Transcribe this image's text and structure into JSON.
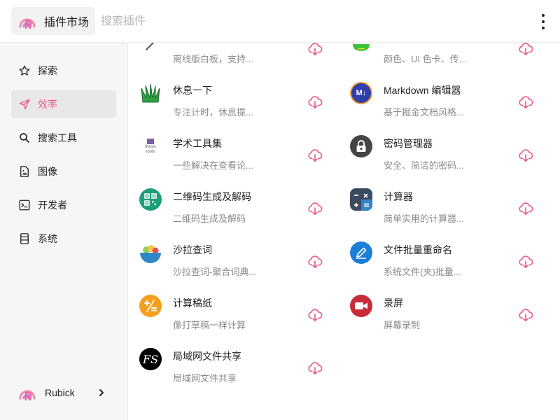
{
  "header": {
    "title": "插件市场",
    "search_placeholder": "搜索插件",
    "menu_icon": "more-vertical-icon"
  },
  "colors": {
    "accent": "#ee5a8f",
    "sidebar_bg": "#f6f6f6",
    "active_bg": "#e8e8e8"
  },
  "sidebar": {
    "items": [
      {
        "label": "探索",
        "icon": "star-icon"
      },
      {
        "label": "效率",
        "icon": "send-icon",
        "active": true
      },
      {
        "label": "搜索工具",
        "icon": "search-icon"
      },
      {
        "label": "图像",
        "icon": "image-file-icon"
      },
      {
        "label": "开发者",
        "icon": "terminal-icon"
      },
      {
        "label": "系统",
        "icon": "list-icon"
      }
    ],
    "user": {
      "name": "Rubick",
      "icon": "rubick-logo-icon"
    }
  },
  "plugins_left": [
    {
      "name": "",
      "desc": "离线版白板，支持...",
      "icon": "whiteboard-icon"
    },
    {
      "name": "休息一下",
      "desc": "专注计时，休息提...",
      "icon": "grass-icon"
    },
    {
      "name": "学术工具集",
      "desc": "一些解决在查看论...",
      "icon": "thesis-tools-icon",
      "logo_lines": [
        "thesis",
        "tools"
      ]
    },
    {
      "name": "二维码生成及解码",
      "desc": "二维码生成及解码",
      "icon": "qrcode-icon"
    },
    {
      "name": "沙拉查词",
      "desc": "沙拉查词-聚合词典...",
      "icon": "salad-bowl-icon"
    },
    {
      "name": "计算稿纸",
      "desc": "像打草稿一样计算",
      "icon": "math-symbols-icon"
    },
    {
      "name": "局域网文件共享",
      "desc": "局域网文件共享",
      "icon": "fs-logo-icon",
      "logo_text": "FS"
    }
  ],
  "plugins_right": [
    {
      "name": "",
      "desc": "颜色、UI 色卡、传...",
      "icon": "color-wheel-icon"
    },
    {
      "name": "Markdown 编辑器",
      "desc": "基于掘金文档风格...",
      "icon": "markdown-icon",
      "logo_text": "M↓"
    },
    {
      "name": "密码管理器",
      "desc": "安全、简洁的密码...",
      "icon": "lock-icon"
    },
    {
      "name": "计算器",
      "desc": "简单实用的计算器...",
      "icon": "calculator-icon"
    },
    {
      "name": "文件批量重命名",
      "desc": "系统文件(夹)批量...",
      "icon": "pencil-icon"
    },
    {
      "name": "录屏",
      "desc": "屏幕录制",
      "icon": "video-camera-icon"
    }
  ],
  "download_icon": "cloud-download-icon"
}
